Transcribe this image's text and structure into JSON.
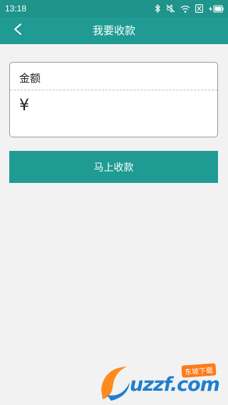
{
  "status_bar": {
    "time": "13:18"
  },
  "header": {
    "title": "我要收款"
  },
  "amount_card": {
    "label": "金额",
    "currency_symbol": "¥",
    "value": "",
    "placeholder": ""
  },
  "actions": {
    "submit_label": "马上收款"
  },
  "watermark": {
    "text": "uzzf.com",
    "badge": "东坡下载"
  },
  "colors": {
    "brand": "#1f9b93",
    "status_bar": "#1f948a",
    "background": "#f2f2f2"
  },
  "icons": [
    "bluetooth-icon",
    "mute-icon",
    "wifi-icon",
    "sim-icon",
    "battery-icon",
    "back-arrow-icon"
  ]
}
